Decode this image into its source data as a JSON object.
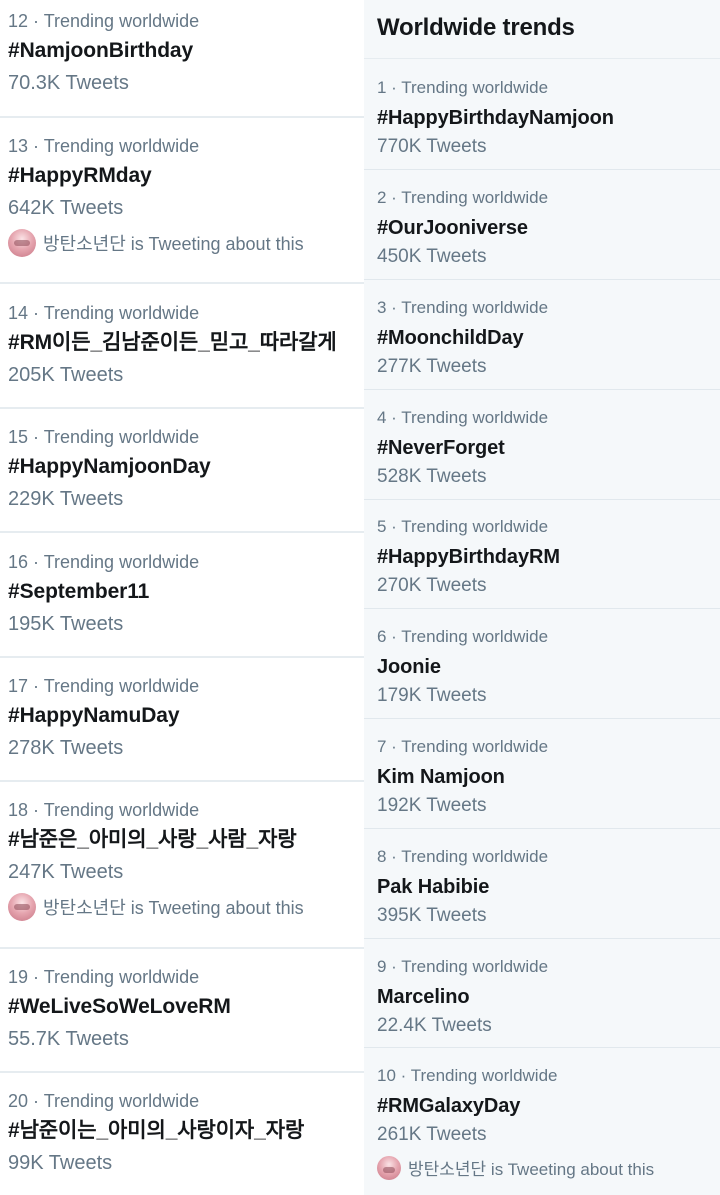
{
  "right_panel": {
    "title": "Worldwide trends",
    "trends": [
      {
        "meta": "1 · Trending worldwide",
        "name": "#HappyBirthdayNamjoon",
        "count": "770K Tweets"
      },
      {
        "meta": "2 · Trending worldwide",
        "name": "#OurJooniverse",
        "count": "450K Tweets"
      },
      {
        "meta": "3 · Trending worldwide",
        "name": "#MoonchildDay",
        "count": "277K Tweets"
      },
      {
        "meta": "4 · Trending worldwide",
        "name": "#NeverForget",
        "count": "528K Tweets"
      },
      {
        "meta": "5 · Trending worldwide",
        "name": "#HappyBirthdayRM",
        "count": "270K Tweets"
      },
      {
        "meta": "6 · Trending worldwide",
        "name": "Joonie",
        "count": "179K Tweets"
      },
      {
        "meta": "7 · Trending worldwide",
        "name": "Kim Namjoon",
        "count": "192K Tweets"
      },
      {
        "meta": "8 · Trending worldwide",
        "name": "Pak Habibie",
        "count": "395K Tweets"
      },
      {
        "meta": "9 · Trending worldwide",
        "name": "Marcelino",
        "count": "22.4K Tweets"
      },
      {
        "meta": "10 · Trending worldwide",
        "name": "#RMGalaxyDay",
        "count": "261K Tweets",
        "context": "방탄소년단 is Tweeting about this"
      }
    ]
  },
  "left_panel": {
    "trends": [
      {
        "meta": "12 · Trending worldwide",
        "name": "#NamjoonBirthday",
        "count": "70.3K Tweets"
      },
      {
        "meta": "13 · Trending worldwide",
        "name": "#HappyRMday",
        "count": "642K Tweets",
        "context": "방탄소년단 is Tweeting about this"
      },
      {
        "meta": "14 · Trending worldwide",
        "name": "#RM이든_김남준이든_믿고_따라갈게",
        "count": "205K Tweets"
      },
      {
        "meta": "15 · Trending worldwide",
        "name": "#HappyNamjoonDay",
        "count": "229K Tweets"
      },
      {
        "meta": "16 · Trending worldwide",
        "name": "#September11",
        "count": "195K Tweets"
      },
      {
        "meta": "17 · Trending worldwide",
        "name": "#HappyNamuDay",
        "count": "278K Tweets"
      },
      {
        "meta": "18 · Trending worldwide",
        "name": "#남준은_아미의_사랑_사람_자랑",
        "count": "247K Tweets",
        "context": "방탄소년단 is Tweeting about this"
      },
      {
        "meta": "19 · Trending worldwide",
        "name": "#WeLiveSoWeLoveRM",
        "count": "55.7K Tweets"
      },
      {
        "meta": "20 · Trending worldwide",
        "name": "#남준이는_아미의_사랑이자_자랑",
        "count": "99K Tweets"
      }
    ]
  },
  "colors": {
    "text_primary": "#14171a",
    "text_secondary": "#657786",
    "right_bg": "#f5f8fa",
    "divider": "#e6ecf0"
  },
  "icons": {
    "context_avatar": "avatar-icon"
  }
}
